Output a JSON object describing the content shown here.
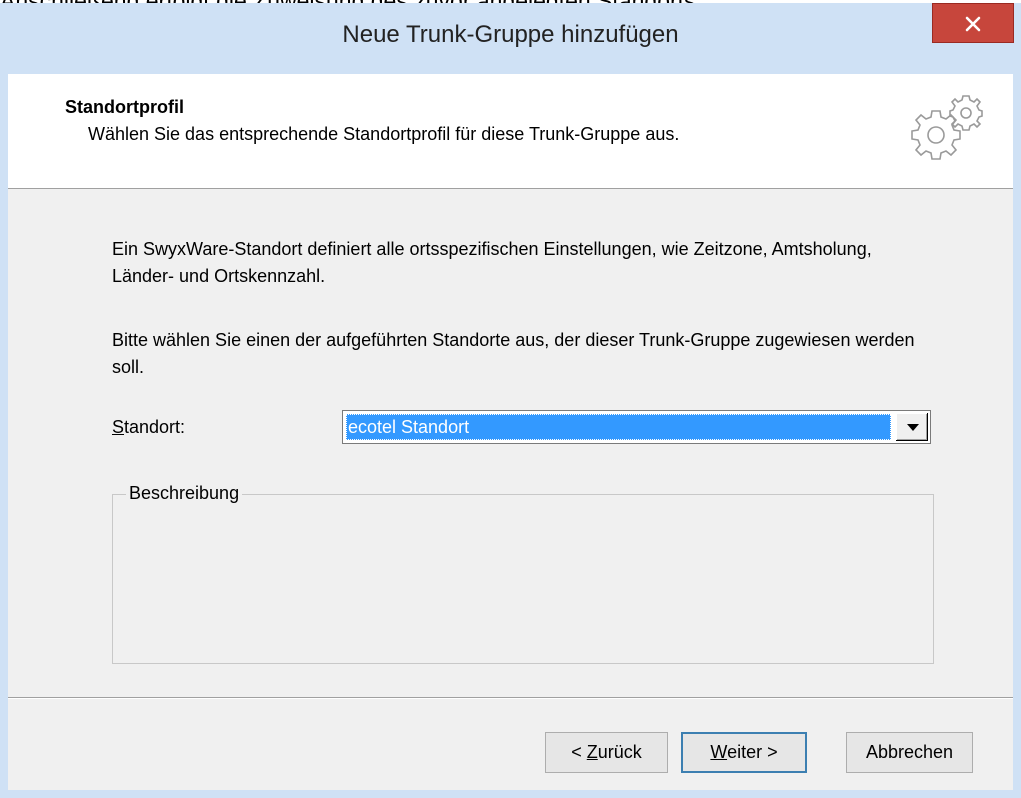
{
  "cut_text": "Anschließend erfolgt die Zuweisung des zuvor angelegten Standorts.",
  "window": {
    "title": "Neue Trunk-Gruppe hinzufügen",
    "close_label": "×"
  },
  "header": {
    "title": "Standortprofil",
    "subtitle": "Wählen Sie das entsprechende Standortprofil für diese Trunk-Gruppe aus.",
    "icon": "gears-icon"
  },
  "body": {
    "paragraph1": "Ein SwyxWare-Standort definiert alle ortsspezifischen Einstellungen, wie Zeitzone, Amtsholung, Länder- und Ortskennzahl.",
    "paragraph2": "Bitte wählen Sie einen der aufgeführten Standorte aus, der dieser Trunk-Gruppe zugewiesen werden soll.",
    "standort_label_access": "S",
    "standort_label_rest": "tandort:",
    "standort_value": "ecotel Standort",
    "description_label": "Beschreibung",
    "description_text": ""
  },
  "buttons": {
    "back_prefix": "< ",
    "back_access": "Z",
    "back_rest": "urück",
    "next_access": "W",
    "next_rest": "eiter >",
    "cancel": "Abbrechen"
  },
  "colors": {
    "title_bar": "#cfe1f5",
    "close_button": "#c7463c",
    "selection": "#3399ff",
    "dialog_bg": "#f0f0f0"
  }
}
